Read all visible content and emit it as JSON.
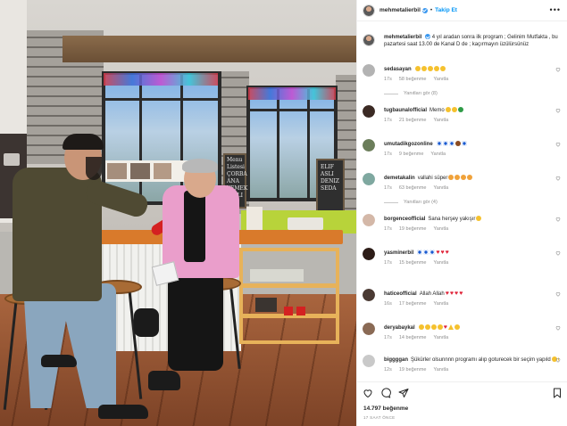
{
  "post": {
    "username": "mehmetalierbil",
    "follow_label": "Takip Et",
    "dot": "•",
    "more_label": "•••",
    "caption_user": "mehmetalierbil",
    "caption_text": "4 yıl aradan sonra ilk program ; Gelinim Mutfakta , bu pazartesi saat 13.00 de Kanal D de ; kaçırmayın üzülürsünüz",
    "likes": "14.797 beğenme",
    "time": "17 SAAT ÖNCE"
  },
  "photo": {
    "board_text": [
      "Menu Listesi",
      "ÇORBA",
      "ANA YEMEK",
      "TATLI"
    ],
    "board2_text": [
      "ELIF",
      "ASLI",
      "DENIZ",
      "SEDA"
    ]
  },
  "comments": [
    {
      "user": "sedasayan",
      "text": "",
      "emojis": [
        "y",
        "y",
        "y",
        "y",
        "y"
      ],
      "time": "17s",
      "likes": "58 beğenme",
      "reply": "Yanıtla",
      "replies": "Yanıtları gör (8)",
      "avatar": "#b3b3b3"
    },
    {
      "user": "tugbaunalofficial",
      "text": "Memo",
      "emojis": [
        "y",
        "y",
        "g"
      ],
      "time": "17s",
      "likes": "21 beğenme",
      "reply": "Yanıtla",
      "replies": "",
      "avatar": "#3b2a24"
    },
    {
      "user": "umutadikgozonline",
      "text": "",
      "emojis": [
        "b",
        "b",
        "b",
        "br",
        "b"
      ],
      "time": "17s",
      "likes": "9 beğenme",
      "reply": "Yanıtla",
      "replies": "",
      "avatar": "#6b7d5a"
    },
    {
      "user": "demetakalin",
      "text": "vallahi süper",
      "emojis": [
        "o",
        "o",
        "o",
        "o"
      ],
      "time": "17s",
      "likes": "63 beğenme",
      "reply": "Yanıtla",
      "replies": "Yanıtları gör (4)",
      "avatar": "#7fa8a0"
    },
    {
      "user": "borgenceofficial",
      "text": "Sana herşey yakışır",
      "emojis": [
        "y"
      ],
      "time": "17s",
      "likes": "19 beğenme",
      "reply": "Yanıtla",
      "replies": "",
      "avatar": "#d4b8a8"
    },
    {
      "user": "yasminerbil",
      "text": "",
      "emojis": [
        "b",
        "b",
        "b",
        "h",
        "h",
        "h"
      ],
      "time": "17s",
      "likes": "15 beğenme",
      "reply": "Yanıtla",
      "replies": "",
      "avatar": "#2d1d18"
    },
    {
      "user": "haticeofficial",
      "text": "Allah Allah",
      "emojis": [
        "h",
        "h",
        "h",
        "h"
      ],
      "time": "16s",
      "likes": "17 beğenme",
      "reply": "Yanıtla",
      "replies": "",
      "avatar": "#4a3a33"
    },
    {
      "user": "deryabaykal",
      "text": "",
      "emojis": [
        "y",
        "y",
        "y",
        "y",
        "h",
        "t",
        "y"
      ],
      "time": "17s",
      "likes": "14 beğenme",
      "reply": "Yanıtla",
      "replies": "",
      "avatar": "#8a6a55"
    },
    {
      "user": "biggggan",
      "text": "Şükürler olsunnnn programı alıp goturecek bir seçim yapıld",
      "emojis": [
        "y",
        "y",
        "y",
        "g",
        "g"
      ],
      "time": "12s",
      "likes": "19 beğenme",
      "reply": "Yanıtla",
      "replies": "",
      "avatar": "#c9c9c9"
    }
  ],
  "colors": {
    "accent": "#0095f6",
    "verified": "#3897f0",
    "muted": "#8e8e8e",
    "heart": "#e0253a"
  },
  "icons": [
    "heart-icon",
    "comment-icon",
    "share-icon",
    "bookmark-icon",
    "more-icon",
    "verified-icon"
  ]
}
